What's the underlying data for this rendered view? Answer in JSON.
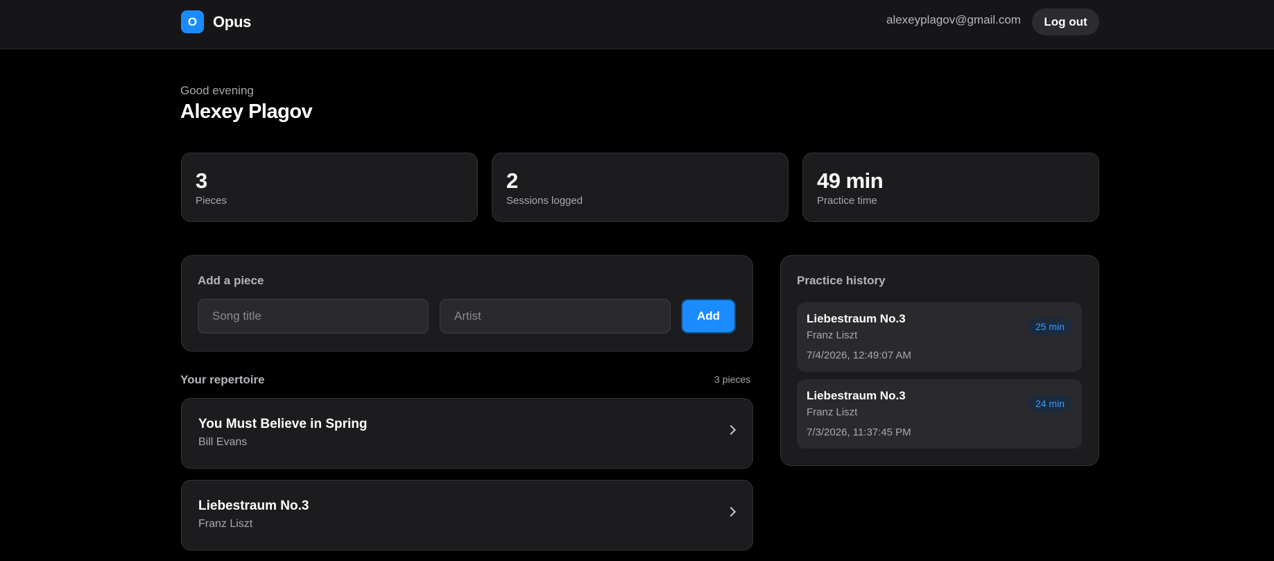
{
  "header": {
    "logo_letter": "O",
    "brand": "Opus",
    "email": "alexeyplagov@gmail.com",
    "logout_label": "Log out"
  },
  "welcome": {
    "greeting": "Good evening",
    "name": "Alexey Plagov"
  },
  "stats": [
    {
      "value": "3",
      "label": "Pieces"
    },
    {
      "value": "2",
      "label": "Sessions logged"
    },
    {
      "value": "49 min",
      "label": "Practice time"
    }
  ],
  "add_piece": {
    "title": "Add a piece",
    "song_placeholder": "Song title",
    "artist_placeholder": "Artist",
    "add_label": "Add"
  },
  "repertoire": {
    "title": "Your repertoire",
    "count": "3 pieces",
    "items": [
      {
        "title": "You Must Believe in Spring",
        "artist": "Bill Evans"
      },
      {
        "title": "Liebestraum No.3",
        "artist": "Franz Liszt"
      }
    ]
  },
  "history": {
    "title": "Practice history",
    "items": [
      {
        "title": "Liebestraum No.3",
        "artist": "Franz Liszt",
        "date": "7/4/2026, 12:49:07 AM",
        "duration": "25 min"
      },
      {
        "title": "Liebestraum No.3",
        "artist": "Franz Liszt",
        "date": "7/3/2026, 11:37:45 PM",
        "duration": "24 min"
      }
    ]
  },
  "colors": {
    "accent": "#1a8cff",
    "background": "#000000",
    "card": "#1c1c1f"
  }
}
